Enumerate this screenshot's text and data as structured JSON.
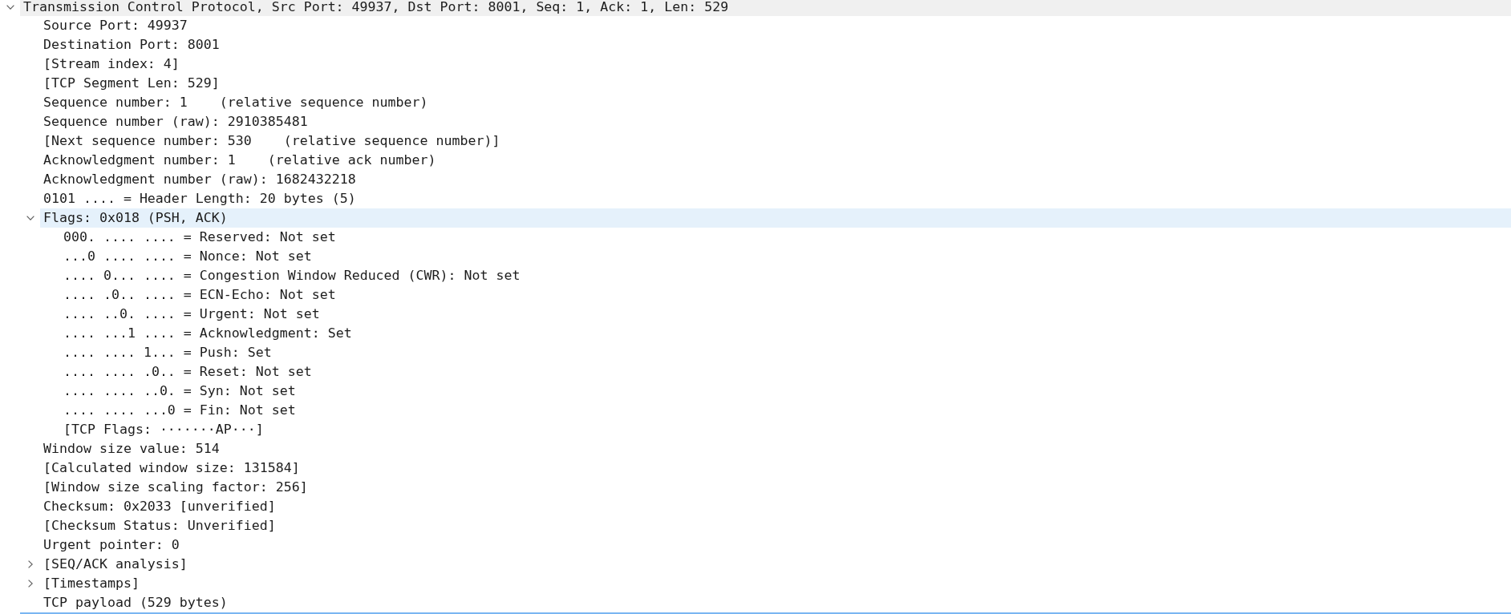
{
  "tree": [
    {
      "kind": "protocol",
      "label": "Transmission Control Protocol, Src Port: 49937, Dst Port: 8001, Seq: 1, Ack: 1, Len: 529",
      "expanded": true,
      "selected": false,
      "children": [
        {
          "kind": "field",
          "label": "Source Port: 49937",
          "selected": false
        },
        {
          "kind": "field",
          "label": "Destination Port: 8001",
          "selected": false
        },
        {
          "kind": "field",
          "label": "[Stream index: 4]",
          "selected": false
        },
        {
          "kind": "field",
          "label": "[TCP Segment Len: 529]",
          "selected": false
        },
        {
          "kind": "field",
          "label": "Sequence number: 1    (relative sequence number)",
          "selected": false
        },
        {
          "kind": "field",
          "label": "Sequence number (raw): 2910385481",
          "selected": false
        },
        {
          "kind": "field",
          "label": "[Next sequence number: 530    (relative sequence number)]",
          "selected": false
        },
        {
          "kind": "field",
          "label": "Acknowledgment number: 1    (relative ack number)",
          "selected": false
        },
        {
          "kind": "field",
          "label": "Acknowledgment number (raw): 1682432218",
          "selected": false
        },
        {
          "kind": "field",
          "label": "0101 .... = Header Length: 20 bytes (5)",
          "selected": false
        },
        {
          "kind": "group",
          "label": "Flags: 0x018 (PSH, ACK)",
          "expanded": true,
          "selected": true,
          "children": [
            {
              "kind": "field",
              "label": "000. .... .... = Reserved: Not set",
              "selected": false
            },
            {
              "kind": "field",
              "label": "...0 .... .... = Nonce: Not set",
              "selected": false
            },
            {
              "kind": "field",
              "label": ".... 0... .... = Congestion Window Reduced (CWR): Not set",
              "selected": false
            },
            {
              "kind": "field",
              "label": ".... .0.. .... = ECN-Echo: Not set",
              "selected": false
            },
            {
              "kind": "field",
              "label": ".... ..0. .... = Urgent: Not set",
              "selected": false
            },
            {
              "kind": "field",
              "label": ".... ...1 .... = Acknowledgment: Set",
              "selected": false
            },
            {
              "kind": "field",
              "label": ".... .... 1... = Push: Set",
              "selected": false
            },
            {
              "kind": "field",
              "label": ".... .... .0.. = Reset: Not set",
              "selected": false
            },
            {
              "kind": "field",
              "label": ".... .... ..0. = Syn: Not set",
              "selected": false
            },
            {
              "kind": "field",
              "label": ".... .... ...0 = Fin: Not set",
              "selected": false
            },
            {
              "kind": "field",
              "label": "[TCP Flags: ·······AP···]",
              "selected": false
            }
          ]
        },
        {
          "kind": "field",
          "label": "Window size value: 514",
          "selected": false
        },
        {
          "kind": "field",
          "label": "[Calculated window size: 131584]",
          "selected": false
        },
        {
          "kind": "field",
          "label": "[Window size scaling factor: 256]",
          "selected": false
        },
        {
          "kind": "field",
          "label": "Checksum: 0x2033 [unverified]",
          "selected": false
        },
        {
          "kind": "field",
          "label": "[Checksum Status: Unverified]",
          "selected": false
        },
        {
          "kind": "field",
          "label": "Urgent pointer: 0",
          "selected": false
        },
        {
          "kind": "group",
          "label": "[SEQ/ACK analysis]",
          "expanded": false,
          "selected": false
        },
        {
          "kind": "group",
          "label": "[Timestamps]",
          "expanded": false,
          "selected": false
        },
        {
          "kind": "field",
          "label": "TCP payload (529 bytes)",
          "selected": false
        }
      ]
    }
  ]
}
